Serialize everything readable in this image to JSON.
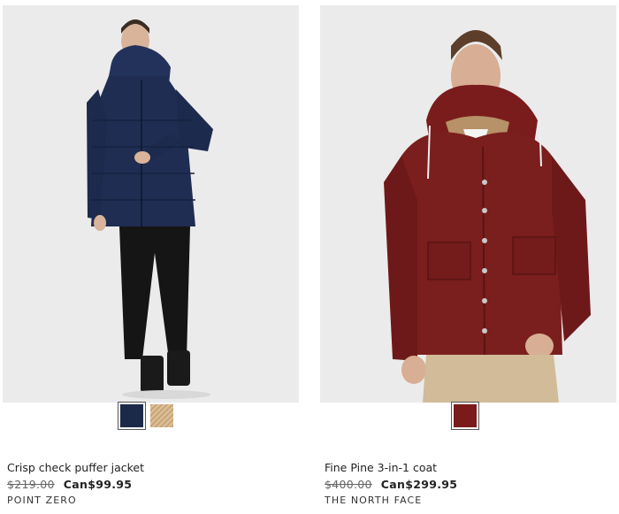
{
  "products": [
    {
      "name": "Crisp check puffer jacket",
      "original_price": "$219.00",
      "sale_price": "Can$99.95",
      "brand": "POINT ZERO",
      "image_desc_icon": "product-photo",
      "swatches": [
        {
          "color": "#1c2a4a",
          "selected": true
        },
        {
          "color": "#d2b48c",
          "selected": false
        }
      ]
    },
    {
      "name": "Fine Pine 3-in-1 coat",
      "original_price": "$400.00",
      "sale_price": "Can$299.95",
      "brand": "THE NORTH FACE",
      "image_desc_icon": "product-photo",
      "swatches": [
        {
          "color": "#7a1a1a",
          "selected": true
        }
      ]
    }
  ],
  "colors": {
    "background": "#ffffff",
    "photo_bg": "#ebebeb"
  }
}
